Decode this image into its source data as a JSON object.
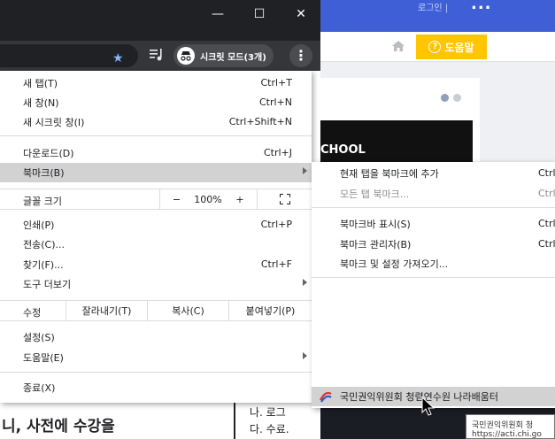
{
  "window": {
    "minimize": "—",
    "maximize": "☐",
    "close": "✕"
  },
  "toolbar": {
    "incognito_label": "시크릿 모드(3개)"
  },
  "menu": {
    "new_tab": {
      "label": "새 탭(T)",
      "shortcut": "Ctrl+T"
    },
    "new_window": {
      "label": "새 창(N)",
      "shortcut": "Ctrl+N"
    },
    "new_incognito": {
      "label": "새 시크릿 창(I)",
      "shortcut": "Ctrl+Shift+N"
    },
    "downloads": {
      "label": "다운로드(D)",
      "shortcut": "Ctrl+J"
    },
    "bookmarks": {
      "label": "북마크(B)"
    },
    "zoom": {
      "label": "글꼴 크기",
      "minus": "−",
      "value": "100%",
      "plus": "+"
    },
    "print": {
      "label": "인쇄(P)",
      "shortcut": "Ctrl+P"
    },
    "cast": {
      "label": "전송(C)..."
    },
    "find": {
      "label": "찾기(F)...",
      "shortcut": "Ctrl+F"
    },
    "more_tools": {
      "label": "도구 더보기"
    },
    "edit": {
      "label": "수정",
      "cut": "잘라내기(T)",
      "copy": "복사(C)",
      "paste": "붙여넣기(P)"
    },
    "settings": {
      "label": "설정(S)"
    },
    "help": {
      "label": "도움말(E)"
    },
    "exit": {
      "label": "종료(X)"
    }
  },
  "submenu": {
    "bookmark_tab": {
      "label": "현재 탭을 북마크에 추가",
      "shortcut": "Ctrl"
    },
    "bookmark_all": {
      "label": "모든 탭 북마크...",
      "shortcut": "Ctrl"
    },
    "show_bar": {
      "label": "북마크바 표시(S)",
      "shortcut": "Ctrl"
    },
    "manager": {
      "label": "북마크 관리자(B)",
      "shortcut": "Ctrl"
    },
    "import": {
      "label": "북마크 및 설정 가져오기..."
    },
    "item": {
      "label": "국민권익위원회 청렴연수원 나라배움터"
    }
  },
  "tooltip": {
    "line1": "국민권익위원회 청",
    "line2": "https://acti.chi.go"
  },
  "background": {
    "top_faint": "로그인 |",
    "help_button": "도움말",
    "banner_text": "CHOOL",
    "left_text": "니, 사전에 수강을",
    "mid_line1": "나. 로그",
    "mid_line2": "다. 수료."
  }
}
